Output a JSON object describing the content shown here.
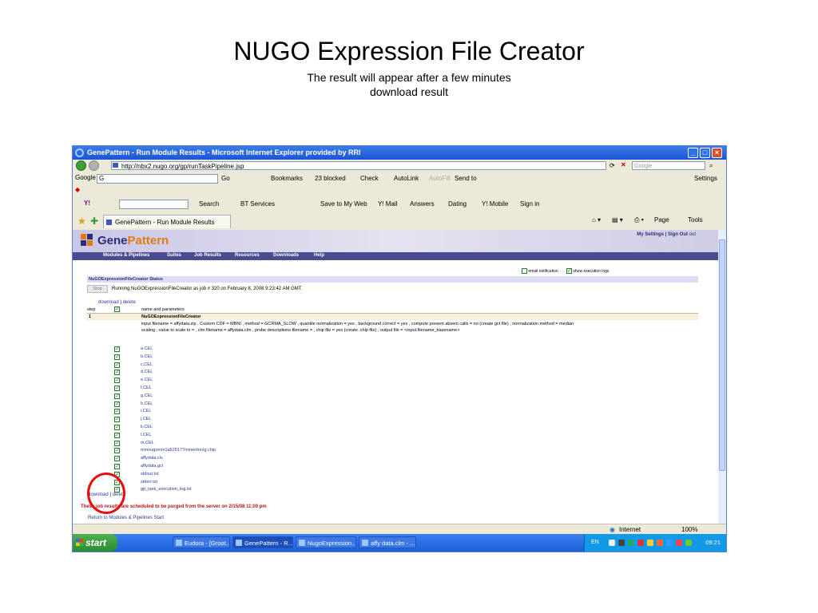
{
  "slide": {
    "title": "NUGO Expression File Creator",
    "subtitle": "The result will appear after a few minutes",
    "subtitle2": "download result"
  },
  "window": {
    "title": "GenePattern - Run Module Results - Microsoft Internet Explorer provided by RRI",
    "url": "http://nbx2.nugo.org/gp/runTaskPipeline.jsp",
    "search_placeholder": "Google"
  },
  "google_toolbar": {
    "logo": "Google",
    "field": "G",
    "go": "Go",
    "bookmarks": "Bookmarks",
    "blocked": "23 blocked",
    "check": "Check",
    "autolink": "AutoLink",
    "autofill": "AutoFill",
    "send": "Send to",
    "settings": "Settings"
  },
  "yahoo_toolbar": {
    "logo": "Y!",
    "search": "Search",
    "bt": "BT Services",
    "save": "Save to My Web",
    "mail": "Y! Mail",
    "answers": "Answers",
    "dating": "Dating",
    "mobile": "Y! Mobile",
    "signin": "Sign in"
  },
  "tab": {
    "label": "GenePattern - Run Module Results",
    "page": "Page",
    "tools": "Tools"
  },
  "gp": {
    "brand_gene": "Gene",
    "brand_pattern": "Pattern",
    "top_links": "My Settings | Sign Out",
    "top_user": "out",
    "menu": [
      "Modules & Pipelines",
      "Suites",
      "Job Results",
      "Resources",
      "Downloads",
      "Help"
    ],
    "email_notification": "email notification",
    "show_logs": "show execution logs",
    "status_header": "NuGOExpressionFileCreator Status",
    "stop": "Stop",
    "running": "Running NuGOExpressionFileCreator as job # 320 on February 8, 2008 9:23:42 AM GMT.",
    "download": "download",
    "separator": "|",
    "delete": "delete",
    "col_step": "step",
    "col_name": "name and parameters",
    "step_number": "1",
    "step_name": "NuGOExpressionFileCreator",
    "params_line1": "input filename = affydata.zip , Custom CDF = MBNI , method = GCRMA_SLOW , quantile normalization = yes , background correct = yes , compute present absent calls = no (create gct file) , normalization method = median",
    "params_line2": "scaling , value to scale to = , clm filename = affydata.clm , probe descriptions filename = , chip file = yes (create .chip file) , output file = <input.filename_basename>",
    "files": [
      "a.CEL",
      "b.CEL",
      "c.CEL",
      "d.CEL",
      "e.CEL",
      "f.CEL",
      "g.CEL",
      "h.CEL",
      "i.CEL",
      "j.CEL",
      "k.CEL",
      "l.CEL",
      "m.CEL",
      "mmnugomm1a520177mmentrezg.chip",
      "affydata.cls",
      "affydata.gct",
      "stdout.txt",
      "stderr.txt",
      "gp_task_execution_log.txt"
    ],
    "purge": "These job results are scheduled to be purged from the server on 2/15/08 11:00 pm",
    "return": "Return to Modules & Pipelines Start"
  },
  "statusbar": {
    "zone": "Internet",
    "zoom": "100%"
  },
  "taskbar": {
    "start": "start",
    "tasks": [
      "Eudora - [Groot...",
      "GenePattern - R...",
      "NugoExpression...",
      "affy data.clm - ..."
    ],
    "lang": "EN",
    "clock": "09:21"
  },
  "colors": {
    "annotation_circle": "#e80d0d",
    "gp_menu": "#4a4a90",
    "purge_text": "#b01818"
  }
}
